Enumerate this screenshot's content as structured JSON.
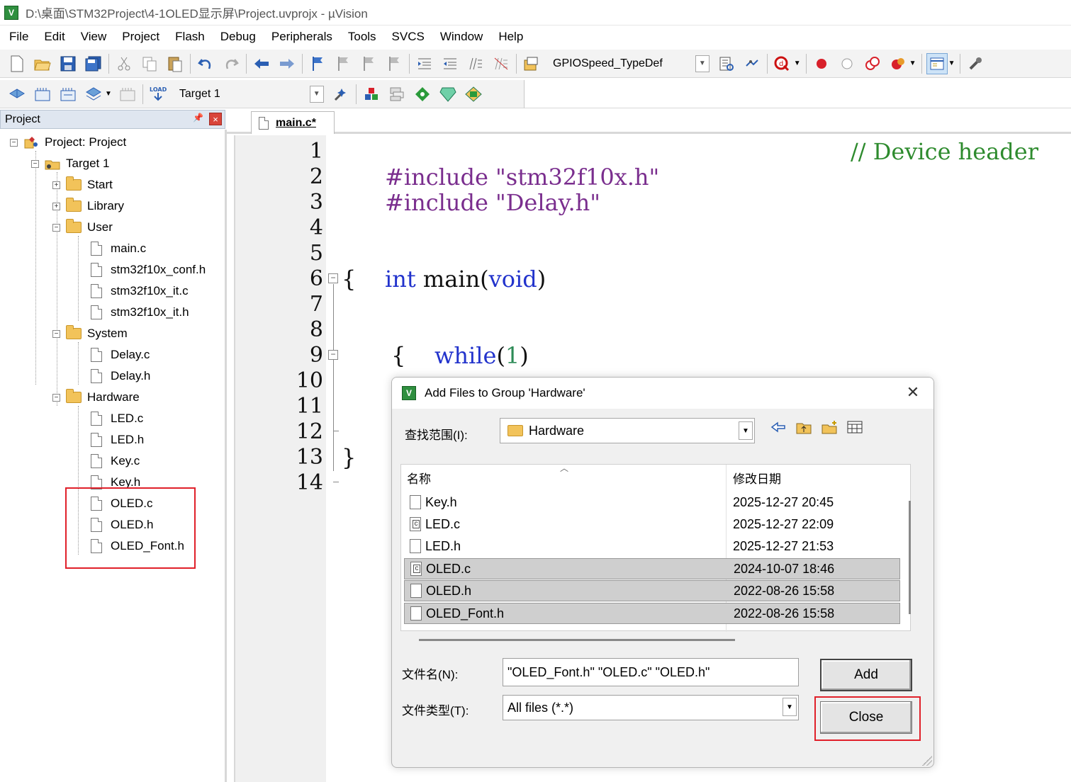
{
  "window": {
    "title": "D:\\桌面\\STM32Project\\4-1OLED显示屏\\Project.uvprojx - µVision",
    "app_icon_letter": "V"
  },
  "menu": [
    "File",
    "Edit",
    "View",
    "Project",
    "Flash",
    "Debug",
    "Peripherals",
    "Tools",
    "SVCS",
    "Window",
    "Help"
  ],
  "toolbar": {
    "combo_value": "GPIOSpeed_TypeDef",
    "target_value": "Target 1"
  },
  "project_panel": {
    "header": "Project",
    "pin": "ᵖ",
    "close": "×",
    "root": "Project: Project",
    "target": "Target 1",
    "groups": [
      {
        "name": "Start",
        "expanded": false,
        "files": []
      },
      {
        "name": "Library",
        "expanded": false,
        "files": []
      },
      {
        "name": "User",
        "expanded": true,
        "files": [
          "main.c",
          "stm32f10x_conf.h",
          "stm32f10x_it.c",
          "stm32f10x_it.h"
        ]
      },
      {
        "name": "System",
        "expanded": true,
        "files": [
          "Delay.c",
          "Delay.h"
        ]
      },
      {
        "name": "Hardware",
        "expanded": true,
        "files": [
          "LED.c",
          "LED.h",
          "Key.c",
          "Key.h",
          "OLED.c",
          "OLED.h",
          "OLED_Font.h"
        ]
      }
    ]
  },
  "editor": {
    "tab_label": "main.c*",
    "line_numbers": [
      "1",
      "2",
      "3",
      "4",
      "5",
      "6",
      "7",
      "8",
      "9",
      "10",
      "11",
      "12",
      "13",
      "14"
    ],
    "lines": {
      "l1_pre": "#include",
      "l1_str": "\"stm32f10x.h\"",
      "l1_cmt": "// Device header",
      "l2_pre": "#include",
      "l2_str": "\"Delay.h\"",
      "l5_kw": "int",
      "l5_rest": "main(",
      "l5_void": "void",
      "l5_close": ")",
      "l6": "{",
      "l8_kw": "while",
      "l8_open": "(",
      "l8_num": "1",
      "l8_close": ")",
      "l9": "{",
      "l13": "}"
    }
  },
  "dialog": {
    "title": "Add Files to Group 'Hardware'",
    "lookin_label": "查找范围(I):",
    "lookin_value": "Hardware",
    "col_name": "名称",
    "col_date": "修改日期",
    "files": [
      {
        "name": "Key.h",
        "date": "2025-12-27 20:45",
        "selected": false,
        "c": false
      },
      {
        "name": "LED.c",
        "date": "2025-12-27 22:09",
        "selected": false,
        "c": true
      },
      {
        "name": "LED.h",
        "date": "2025-12-27 21:53",
        "selected": false,
        "c": false
      },
      {
        "name": "OLED.c",
        "date": "2024-10-07 18:46",
        "selected": true,
        "c": true
      },
      {
        "name": "OLED.h",
        "date": "2022-08-26 15:58",
        "selected": true,
        "c": false
      },
      {
        "name": "OLED_Font.h",
        "date": "2022-08-26 15:58",
        "selected": true,
        "c": false
      }
    ],
    "filename_label": "文件名(N):",
    "filename_value": "\"OLED_Font.h\" \"OLED.c\" \"OLED.h\"",
    "filetype_label": "文件类型(T):",
    "filetype_value": "All files (*.*)",
    "add_label": "Add",
    "close_label": "Close",
    "close_x": "✕"
  }
}
